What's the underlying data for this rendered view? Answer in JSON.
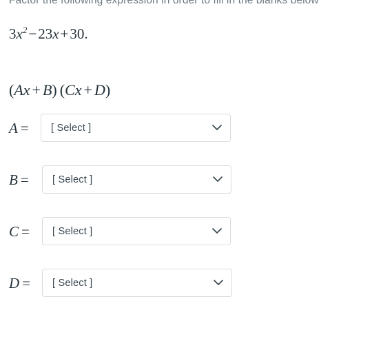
{
  "instruction": "Factor the following expression in order to fill in the blanks below",
  "expression": {
    "coefficient_a": "3",
    "variable": "x",
    "exponent": "2",
    "op1": "−",
    "coefficient_b": "23",
    "variable2": "x",
    "op2": "+",
    "constant": "30",
    "period": ".",
    "plain_text": "3x^2 - 23x + 30."
  },
  "factored_form": {
    "open1": "(",
    "a": "A",
    "x1": "x",
    "plus1": "+",
    "b": "B",
    "close1": ")",
    "open2": "(",
    "c": "C",
    "x2": "x",
    "plus2": "+",
    "d": "D",
    "close2": ")",
    "plain_text": "(Ax + B) (Cx + D)"
  },
  "blanks": [
    {
      "id": "A",
      "label_var": "A",
      "label_eq": "=",
      "placeholder": "[ Select ]",
      "value": "[ Select ]",
      "icon": "chevron-down-icon"
    },
    {
      "id": "B",
      "label_var": "B",
      "label_eq": "=",
      "placeholder": "[ Select ]",
      "value": "[ Select ]",
      "icon": "chevron-down-icon"
    },
    {
      "id": "C",
      "label_var": "C",
      "label_eq": "=",
      "placeholder": "[ Select ]",
      "value": "[ Select ]",
      "icon": "chevron-down-icon"
    },
    {
      "id": "D",
      "label_var": "D",
      "label_eq": "=",
      "placeholder": "[ Select ]",
      "value": "[ Select ]",
      "icon": "chevron-down-icon"
    }
  ],
  "colors": {
    "page_background": "#ffffff",
    "instruction_text": "#6d7a82",
    "math_text": "#25323a",
    "select_border": "#d7dbdf",
    "select_text": "#3a4750",
    "chevron": "#3a4750"
  }
}
